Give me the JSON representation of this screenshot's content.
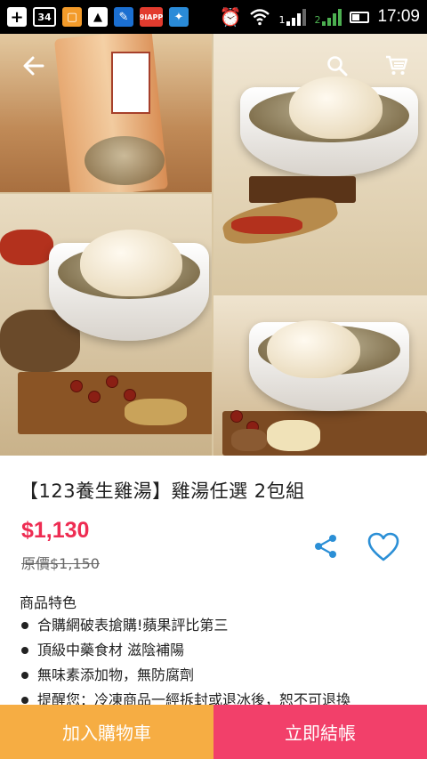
{
  "status_bar": {
    "notification_count": "34",
    "app_badge": "9IAPP",
    "signal_a": "1",
    "signal_b": "2",
    "time": "17:09"
  },
  "nav": {
    "back_icon": "arrow-left-icon",
    "search_icon": "search-icon",
    "cart_icon": "cart-icon"
  },
  "product": {
    "title": "【123養生雞湯】雞湯任選 2包組",
    "price": "$1,130",
    "original_price": "原價$1,150",
    "features_title": "商品特色",
    "features": [
      "合購網破表搶購!蘋果評比第三",
      "頂級中藥食材 滋陰補陽",
      "無味素添加物，無防腐劑",
      "提醒您：冷凍商品一經拆封或退冰後，恕不可退換"
    ]
  },
  "actions": {
    "add_to_cart": "加入購物車",
    "buy_now": "立即結帳"
  },
  "colors": {
    "accent_pink": "#ee2c52",
    "icon_blue": "#2b8fd6",
    "cart_button": "#f6ad43",
    "buy_button": "#f2406a"
  }
}
